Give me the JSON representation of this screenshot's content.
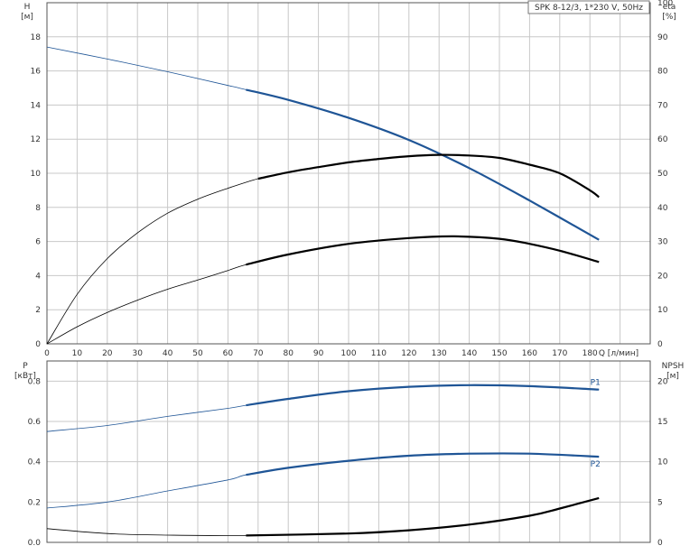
{
  "chart_data": [
    {
      "type": "line",
      "title": "SPK 8-12/3, 1*230 V, 50Hz",
      "xlabel": "Q [л/мин]",
      "ylabel": "H",
      "ylabel_unit": "[м]",
      "y2label": "eta",
      "y2label_unit": "[%]",
      "xlim": [
        0,
        200
      ],
      "ylim": [
        0,
        20
      ],
      "y2lim": [
        0,
        100
      ],
      "xticks": [
        "0",
        "10",
        "20",
        "30",
        "40",
        "50",
        "60",
        "70",
        "80",
        "90",
        "100",
        "110",
        "120",
        "130",
        "140",
        "150",
        "160",
        "170",
        "180"
      ],
      "yticks": [
        "0",
        "2",
        "4",
        "6",
        "8",
        "10",
        "12",
        "14",
        "16",
        "18"
      ],
      "y2ticks": [
        "0",
        "10",
        "20",
        "30",
        "40",
        "50",
        "60",
        "70",
        "80",
        "90",
        "100"
      ],
      "grid": true,
      "duty_range": [
        66,
        183
      ],
      "series": [
        {
          "key": "H",
          "axis": "left",
          "color": "#1f5596",
          "x": [
            0,
            20,
            40,
            60,
            66,
            80,
            100,
            120,
            140,
            160,
            183
          ],
          "y": [
            17.4,
            16.7,
            15.95,
            15.15,
            14.9,
            14.3,
            13.25,
            11.95,
            10.3,
            8.4,
            6.1
          ]
        },
        {
          "key": "eta",
          "axis": "right",
          "color": "#000000",
          "x": [
            0,
            10,
            20,
            30,
            40,
            50,
            60,
            70,
            80,
            90,
            100,
            110,
            120,
            130,
            140,
            150,
            160,
            170,
            180,
            183
          ],
          "y": [
            0,
            14.5,
            25,
            32.5,
            38.3,
            42.4,
            45.6,
            48.4,
            50.3,
            51.8,
            53.2,
            54.2,
            55,
            55.4,
            55.2,
            54.5,
            52.5,
            50,
            45,
            43
          ]
        },
        {
          "key": "eta_pump",
          "axis": "right",
          "color": "#000000",
          "x": [
            0,
            10,
            20,
            30,
            40,
            50,
            60,
            66,
            80,
            100,
            120,
            135,
            150,
            160,
            170,
            183
          ],
          "y": [
            0,
            5,
            9.2,
            12.8,
            16,
            18.7,
            21.5,
            23.2,
            26.2,
            29.3,
            31,
            31.5,
            30.8,
            29.3,
            27.3,
            24
          ]
        }
      ]
    },
    {
      "type": "line",
      "xlabel": "",
      "ylabel": "P",
      "ylabel_unit": "[кВт]",
      "y2label": "NPSH",
      "y2label_unit": "[м]",
      "xlim": [
        0,
        200
      ],
      "ylim": [
        0,
        0.9
      ],
      "y2lim": [
        0,
        22.5
      ],
      "yticks": [
        "0.0",
        "0.2",
        "0.4",
        "0.6",
        "0.8"
      ],
      "y2ticks": [
        "0",
        "5",
        "10",
        "15",
        "20"
      ],
      "grid": true,
      "duty_range": [
        66,
        183
      ],
      "series": [
        {
          "key": "P1",
          "name": "P1",
          "axis": "left",
          "color": "#1f5596",
          "x": [
            0,
            20,
            40,
            60,
            66,
            80,
            100,
            120,
            140,
            160,
            183
          ],
          "y": [
            0.55,
            0.58,
            0.625,
            0.665,
            0.68,
            0.712,
            0.75,
            0.772,
            0.78,
            0.775,
            0.758
          ]
        },
        {
          "key": "P2",
          "name": "P2",
          "axis": "left",
          "color": "#1f5596",
          "x": [
            0,
            20,
            40,
            60,
            66,
            80,
            100,
            120,
            140,
            160,
            183
          ],
          "y": [
            0.17,
            0.2,
            0.255,
            0.31,
            0.335,
            0.37,
            0.405,
            0.43,
            0.44,
            0.44,
            0.425
          ]
        },
        {
          "key": "NPSH",
          "axis": "right",
          "color": "#000000",
          "x": [
            0,
            20,
            40,
            66,
            100,
            120,
            140,
            160,
            170,
            183
          ],
          "y": [
            1.7,
            1.1,
            0.9,
            0.85,
            1.1,
            1.5,
            2.2,
            3.3,
            4.2,
            5.5
          ]
        }
      ]
    }
  ]
}
